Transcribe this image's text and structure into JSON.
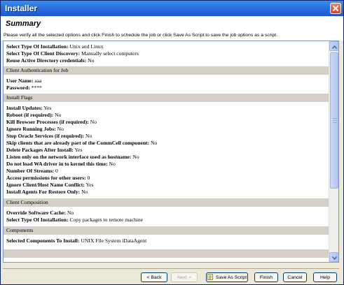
{
  "window": {
    "title": "Installer"
  },
  "header": {
    "title": "Summary",
    "subtitle": "Please verify all the selected options and click Finish to schedule the job or click Save As Script to save the job options as a script."
  },
  "summary": {
    "rows": [
      {
        "key": "Select Type Of Installation:",
        "value": "Unix and Linux"
      },
      {
        "key": "Select Type Of Client Discovery:",
        "value": "Manually select computers"
      },
      {
        "key": "Reuse Active Directory credentials:",
        "value": "No"
      }
    ],
    "sections": [
      {
        "title": "Client Authentication for Job"
      },
      {
        "title": "Install Flags"
      },
      {
        "title": "Client Composition"
      },
      {
        "title": "Components"
      }
    ],
    "auth_rows": [
      {
        "key": "User Name:",
        "value": "aaa"
      },
      {
        "key": "Password:",
        "value": "****"
      }
    ],
    "flag_rows": [
      {
        "key": "Install Updates:",
        "value": "Yes"
      },
      {
        "key": "Reboot (if required):",
        "value": "No"
      },
      {
        "key": "Kill Browser Processes (if required):",
        "value": "No"
      },
      {
        "key": "Ignore Running Jobs:",
        "value": "No"
      },
      {
        "key": "Stop Oracle Services (if required):",
        "value": "No"
      },
      {
        "key": "Skip clients that are already part of the CommCell component:",
        "value": "No"
      },
      {
        "key": "Delete Packages After Install:",
        "value": "Yes"
      },
      {
        "key": "Listen only on the network interface used as hostname:",
        "value": "No"
      },
      {
        "key": "Do not load WA driver in to kernel this time:",
        "value": "No"
      },
      {
        "key": "Number Of Streams:",
        "value": "0"
      },
      {
        "key": "Access permissions for other users:",
        "value": "0"
      },
      {
        "key": "Ignore Client/Host Name Conflict:",
        "value": "Yes"
      },
      {
        "key": "Install Agents For Restore Only:",
        "value": "No"
      }
    ],
    "composition_rows": [
      {
        "key": "Override Software Cache:",
        "value": "No"
      },
      {
        "key": "Select Type Of Installation:",
        "value": "Copy packages to remote machine"
      }
    ],
    "component_rows": [
      {
        "key": "Selected Components To Install:",
        "value": "UNIX File System iDataAgent"
      }
    ]
  },
  "buttons": {
    "back": "< Back",
    "next": "Next >",
    "save_script": "Save As Script",
    "finish": "Finish",
    "cancel": "Cancel",
    "help": "Help"
  },
  "icons": {
    "close": "close-icon",
    "save_script": "script-icon",
    "scroll_up": "arrow-up-icon",
    "scroll_down": "arrow-down-icon"
  },
  "colors": {
    "titlebar": "#2a6fe0",
    "section_bg": "#d4d0c8",
    "dialog_bg": "#ece9d8"
  }
}
